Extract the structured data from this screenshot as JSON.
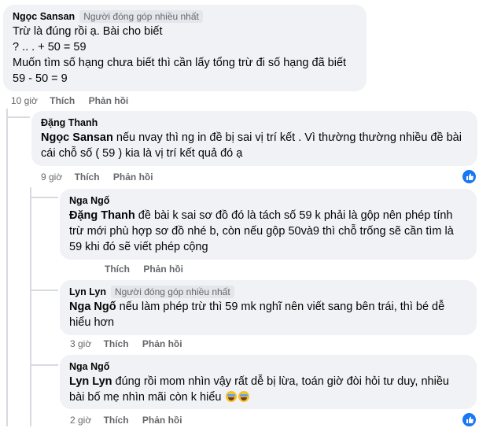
{
  "comments": [
    {
      "author": "Ngọc Sansan",
      "badge": "Người đóng góp nhiều nhất",
      "lines": "Trừ là đúng rồi ạ. Bài cho biết\n? .. . + 50 = 59\nMuốn tìm số hạng chưa biết thì cần lấy tổng trừ đi số hạng đã biết\n59 - 50 = 9",
      "time": "10 giờ",
      "like": "Thích",
      "reply": "Phản hồi"
    },
    {
      "author": "Đặng Thanh",
      "mention": "Ngọc Sansan",
      "text": " nếu nvay thì ng in đề bị sai vị trí kết . Vì thường thường nhiều đề bài cái chỗ số ( 59 ) kia là vị trí kết quả đó ạ",
      "time": "9 giờ",
      "like": "Thích",
      "reply": "Phản hồi"
    },
    {
      "author": "Nga Ngố",
      "mention": "Đặng Thanh",
      "text": " đề bài k sai sơ đồ đó là tách số 59 k phải là gộp nên phép tính trừ mới phù hợp sơ đồ nhé b, còn nếu gộp 50và9 thì chỗ trống sẽ cần tìm là 59 khi đó sẽ viết phép cộng",
      "time": "",
      "like": "Thích",
      "reply": "Phản hồi"
    },
    {
      "author": "Lyn Lyn",
      "badge": "Người đóng góp nhiều nhất",
      "mention": "Nga Ngố",
      "text": " nếu làm phép trừ thì 59 mk nghĩ nên viết sang bên trái, thì bé dễ hiểu hơn",
      "time": "3 giờ",
      "like": "Thích",
      "reply": "Phản hồi"
    },
    {
      "author": "Nga Ngố",
      "mention": "Lyn Lyn",
      "text": " đúng rồi mom nhìn vậy rất dễ bị lừa, toán giờ đòi hỏi tư duy, nhiều bài bố mẹ nhìn mãi còn k hiểu",
      "time": "2 giờ",
      "like": "Thích",
      "reply": "Phản hồi"
    }
  ],
  "colors": {
    "bubble": "#f0f2f5",
    "meta": "#65676b",
    "like_blue": "#1877f2",
    "line": "#d7dadf"
  },
  "icons": {
    "like_reaction": "thumbs-up-icon",
    "emoji": "laughing-tears-emoji"
  }
}
